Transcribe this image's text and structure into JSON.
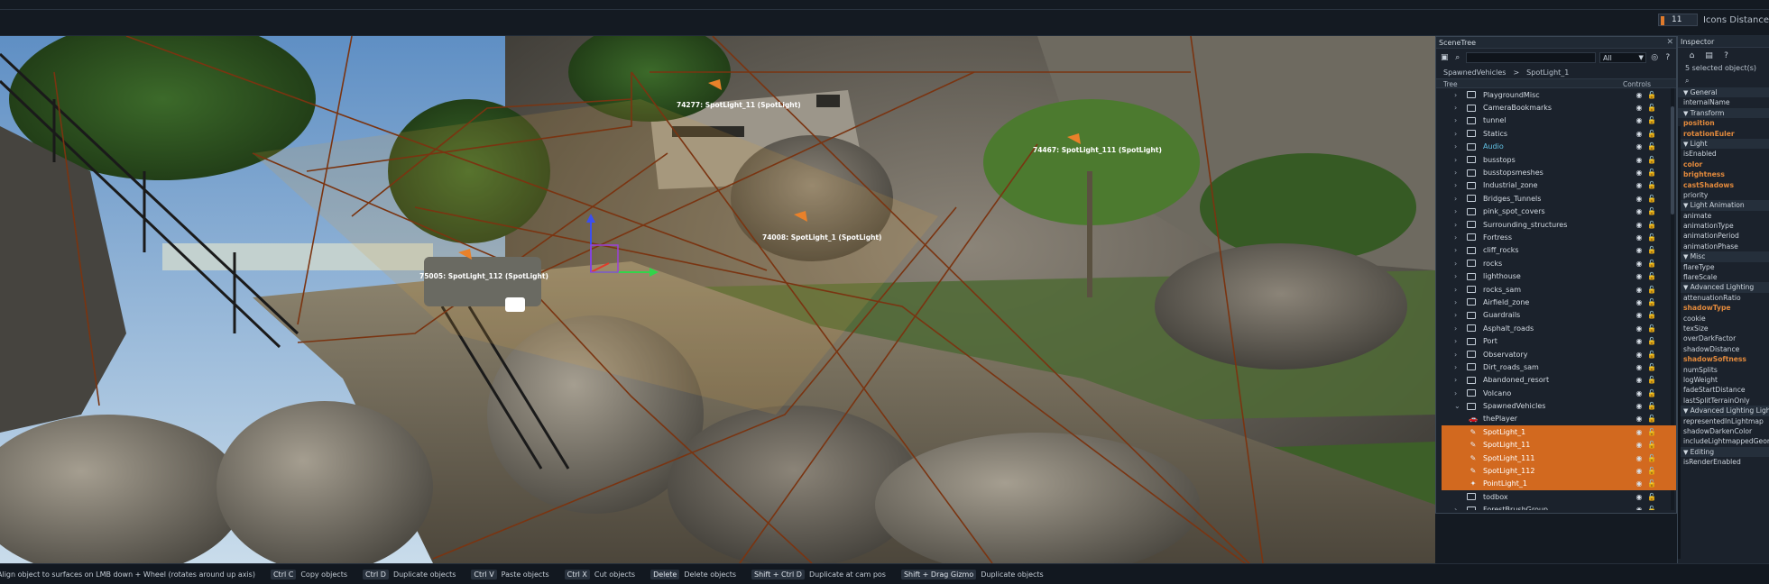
{
  "topbar": {
    "icons_distance_value": "11",
    "icons_distance_label": "Icons Distance"
  },
  "viewport": {
    "labels": [
      {
        "text": "74277: SpotLight_11 (SpotLight)"
      },
      {
        "text": "74467: SpotLight_111 (SpotLight)"
      },
      {
        "text": "74008: SpotLight_1 (SpotLight)"
      },
      {
        "text": "75005: SpotLight_112 (SpotLight)"
      }
    ]
  },
  "scenetree": {
    "title": "SceneTree",
    "filter_value": "All",
    "breadcrumb": [
      "SpawnedVehicles",
      ">",
      "SpotLight_1"
    ],
    "col_tree": "Tree",
    "col_controls": "Controls",
    "rows": [
      {
        "label": "PlaygroundMisc",
        "type": "folder"
      },
      {
        "label": "CameraBookmarks",
        "type": "folder"
      },
      {
        "label": "tunnel",
        "type": "folder"
      },
      {
        "label": "Statics",
        "type": "folder"
      },
      {
        "label": "Audio",
        "type": "folder"
      },
      {
        "label": "busstops",
        "type": "folder"
      },
      {
        "label": "busstopsmeshes",
        "type": "folder"
      },
      {
        "label": "Industrial_zone",
        "type": "folder"
      },
      {
        "label": "Bridges_Tunnels",
        "type": "folder"
      },
      {
        "label": "pink_spot_covers",
        "type": "folder"
      },
      {
        "label": "Surrounding_structures",
        "type": "folder"
      },
      {
        "label": "Fortress",
        "type": "folder"
      },
      {
        "label": "cliff_rocks",
        "type": "folder"
      },
      {
        "label": "rocks",
        "type": "folder"
      },
      {
        "label": "lighthouse",
        "type": "folder"
      },
      {
        "label": "rocks_sam",
        "type": "folder"
      },
      {
        "label": "Airfield_zone",
        "type": "folder"
      },
      {
        "label": "Guardrails",
        "type": "folder"
      },
      {
        "label": "Asphalt_roads",
        "type": "folder"
      },
      {
        "label": "Port",
        "type": "folder"
      },
      {
        "label": "Observatory",
        "type": "folder"
      },
      {
        "label": "Dirt_roads_sam",
        "type": "folder"
      },
      {
        "label": "Abandoned_resort",
        "type": "folder"
      },
      {
        "label": "Volcano",
        "type": "folder"
      },
      {
        "label": "SpawnedVehicles",
        "type": "open"
      },
      {
        "label": "thePlayer",
        "type": "car"
      },
      {
        "label": "SpotLight_1",
        "type": "light",
        "selected": true
      },
      {
        "label": "SpotLight_11",
        "type": "light",
        "selected": true
      },
      {
        "label": "SpotLight_111",
        "type": "light",
        "selected": true
      },
      {
        "label": "SpotLight_112",
        "type": "light",
        "selected": true
      },
      {
        "label": "PointLight_1",
        "type": "point",
        "selected": true
      },
      {
        "label": "todbox",
        "type": "box"
      },
      {
        "label": "ForestBrushGroup",
        "type": "folder"
      }
    ]
  },
  "inspector": {
    "title": "Inspector",
    "selected_count": "5 selected object(s)",
    "rows": [
      {
        "t": "section",
        "label": "General"
      },
      {
        "t": "prop",
        "label": "internalName"
      },
      {
        "t": "section",
        "label": "Transform"
      },
      {
        "t": "orange",
        "label": "position"
      },
      {
        "t": "orange",
        "label": "rotationEuler"
      },
      {
        "t": "section",
        "label": "Light"
      },
      {
        "t": "prop",
        "label": "isEnabled"
      },
      {
        "t": "orange",
        "label": "color"
      },
      {
        "t": "orange",
        "label": "brightness"
      },
      {
        "t": "orange",
        "label": "castShadows"
      },
      {
        "t": "prop",
        "label": "priority"
      },
      {
        "t": "section",
        "label": "Light Animation"
      },
      {
        "t": "prop",
        "label": "animate"
      },
      {
        "t": "prop",
        "label": "animationType"
      },
      {
        "t": "prop",
        "label": "animationPeriod"
      },
      {
        "t": "prop",
        "label": "animationPhase"
      },
      {
        "t": "section",
        "label": "Misc"
      },
      {
        "t": "prop",
        "label": "flareType"
      },
      {
        "t": "prop",
        "label": "flareScale"
      },
      {
        "t": "section",
        "label": "Advanced Lighting"
      },
      {
        "t": "prop",
        "label": "attenuationRatio"
      },
      {
        "t": "orange",
        "label": "shadowType"
      },
      {
        "t": "prop",
        "label": "cookie"
      },
      {
        "t": "prop",
        "label": "texSize"
      },
      {
        "t": "prop",
        "label": "overDarkFactor"
      },
      {
        "t": "prop",
        "label": "shadowDistance"
      },
      {
        "t": "orange",
        "label": "shadowSoftness"
      },
      {
        "t": "prop",
        "label": "numSplits"
      },
      {
        "t": "prop",
        "label": "logWeight"
      },
      {
        "t": "prop",
        "label": "fadeStartDistance"
      },
      {
        "t": "prop",
        "label": "lastSplitTerrainOnly"
      },
      {
        "t": "section",
        "label": "Advanced Lighting Lightmap"
      },
      {
        "t": "prop",
        "label": "representedInLightmap"
      },
      {
        "t": "prop",
        "label": "shadowDarkenColor"
      },
      {
        "t": "prop",
        "label": "includeLightmappedGeometry"
      },
      {
        "t": "section",
        "label": "Editing"
      },
      {
        "t": "prop",
        "label": "isRenderEnabled"
      }
    ]
  },
  "statusbar": [
    {
      "key": "",
      "text": "Align object to surfaces on LMB down + Wheel (rotates around up axis)"
    },
    {
      "key": "Ctrl C",
      "text": "Copy objects"
    },
    {
      "key": "Ctrl D",
      "text": "Duplicate objects"
    },
    {
      "key": "Ctrl V",
      "text": "Paste objects"
    },
    {
      "key": "Ctrl X",
      "text": "Cut objects"
    },
    {
      "key": "Delete",
      "text": "Delete objects"
    },
    {
      "key": "Shift + Ctrl D",
      "text": "Duplicate at cam pos"
    },
    {
      "key": "Shift + Drag Gizmo",
      "text": "Duplicate objects"
    }
  ]
}
